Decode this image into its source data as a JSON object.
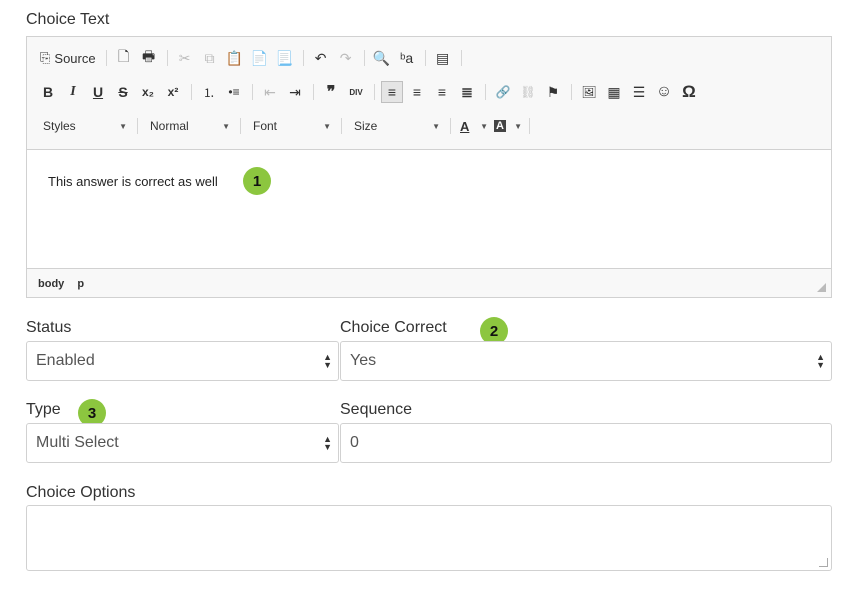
{
  "choice_text": {
    "label": "Choice Text",
    "toolbar": {
      "row1": [
        {
          "icon": "source-icon",
          "glyph": "⎘",
          "label": "Source"
        },
        {
          "icon": "preview-icon",
          "glyph": "🗋"
        },
        {
          "icon": "print-icon",
          "glyph": "🖶"
        },
        {
          "icon": "cut-icon",
          "glyph": "✂"
        },
        {
          "icon": "copy-icon",
          "glyph": "⧉"
        },
        {
          "icon": "paste-icon",
          "glyph": "📋"
        },
        {
          "icon": "paste-text-icon",
          "glyph": "📄"
        },
        {
          "icon": "paste-word-icon",
          "glyph": "📃"
        },
        {
          "icon": "undo-icon",
          "glyph": "↶"
        },
        {
          "icon": "redo-icon",
          "glyph": "↷"
        },
        {
          "icon": "find-icon",
          "glyph": "🔍"
        },
        {
          "icon": "replace-icon",
          "glyph": "ᵇa"
        },
        {
          "icon": "show-blocks-icon",
          "glyph": "▤"
        }
      ],
      "row2": [
        {
          "icon": "bold-icon",
          "glyph": "B"
        },
        {
          "icon": "italic-icon",
          "glyph": "I"
        },
        {
          "icon": "underline-icon",
          "glyph": "U"
        },
        {
          "icon": "strikethrough-icon",
          "glyph": "S"
        },
        {
          "icon": "subscript-icon",
          "glyph": "x₂"
        },
        {
          "icon": "superscript-icon",
          "glyph": "x²"
        },
        {
          "icon": "numbered-list-icon",
          "glyph": "⒈"
        },
        {
          "icon": "bulleted-list-icon",
          "glyph": "•≡"
        },
        {
          "icon": "outdent-icon",
          "glyph": "⇤"
        },
        {
          "icon": "indent-icon",
          "glyph": "⇥"
        },
        {
          "icon": "blockquote-icon",
          "glyph": "❞"
        },
        {
          "icon": "div-icon",
          "glyph": "DIV"
        },
        {
          "icon": "align-left-icon",
          "glyph": "≡"
        },
        {
          "icon": "align-center-icon",
          "glyph": "≡"
        },
        {
          "icon": "align-right-icon",
          "glyph": "≡"
        },
        {
          "icon": "justify-icon",
          "glyph": "≣"
        },
        {
          "icon": "link-icon",
          "glyph": "🔗"
        },
        {
          "icon": "unlink-icon",
          "glyph": "⛓"
        },
        {
          "icon": "anchor-flag-icon",
          "glyph": "⚑"
        },
        {
          "icon": "image-icon",
          "glyph": "🖼"
        },
        {
          "icon": "table-icon",
          "glyph": "▦"
        },
        {
          "icon": "horizontal-line-icon",
          "glyph": "☰"
        },
        {
          "icon": "smiley-icon",
          "glyph": "☺"
        },
        {
          "icon": "special-char-icon",
          "glyph": "Ω"
        }
      ],
      "row3": {
        "styles": "Styles",
        "format": "Normal",
        "font": "Font",
        "size": "Size",
        "text_color": "A",
        "bg_color": "A"
      }
    },
    "content": "This answer is correct as well",
    "elements_path": [
      "body",
      "p"
    ]
  },
  "status": {
    "label": "Status",
    "value": "Enabled"
  },
  "choice_correct": {
    "label": "Choice Correct",
    "value": "Yes"
  },
  "type": {
    "label": "Type",
    "value": "Multi Select"
  },
  "sequence": {
    "label": "Sequence",
    "value": "0"
  },
  "choice_options": {
    "label": "Choice Options",
    "value": ""
  },
  "badges": {
    "one": "1",
    "two": "2",
    "three": "3"
  },
  "colors": {
    "badge": "#8cc63f",
    "border": "#d1d1d1",
    "toolbar_bg": "#f8f8f8"
  }
}
